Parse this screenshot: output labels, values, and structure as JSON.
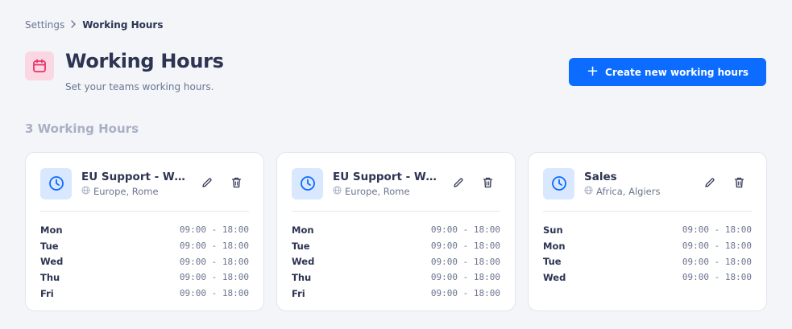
{
  "breadcrumb": {
    "parent": "Settings",
    "separator": "›",
    "current": "Working Hours"
  },
  "header": {
    "title": "Working Hours",
    "subtitle": "Set your teams working hours.",
    "create_button_label": "Create new working hours",
    "create_button_icon": "+"
  },
  "section": {
    "count_label": "3 Working Hours"
  },
  "colors": {
    "accent": "#0b6cff",
    "page_icon_bg": "#fbd7e3",
    "page_icon_fg": "#e8336b",
    "clock_bg": "#d9e8ff"
  },
  "cards": [
    {
      "name": "EU Support - We...",
      "timezone": "Europe, Rome",
      "schedule": [
        {
          "day": "Mon",
          "hours": "09:00 - 18:00"
        },
        {
          "day": "Tue",
          "hours": "09:00 - 18:00"
        },
        {
          "day": "Wed",
          "hours": "09:00 - 18:00"
        },
        {
          "day": "Thu",
          "hours": "09:00 - 18:00"
        },
        {
          "day": "Fri",
          "hours": "09:00 - 18:00"
        }
      ]
    },
    {
      "name": "EU Support - We...",
      "timezone": "Europe, Rome",
      "schedule": [
        {
          "day": "Mon",
          "hours": "09:00 - 18:00"
        },
        {
          "day": "Tue",
          "hours": "09:00 - 18:00"
        },
        {
          "day": "Wed",
          "hours": "09:00 - 18:00"
        },
        {
          "day": "Thu",
          "hours": "09:00 - 18:00"
        },
        {
          "day": "Fri",
          "hours": "09:00 - 18:00"
        }
      ]
    },
    {
      "name": "Sales",
      "timezone": "Africa, Algiers",
      "schedule": [
        {
          "day": "Sun",
          "hours": "09:00 - 18:00"
        },
        {
          "day": "Mon",
          "hours": "09:00 - 18:00"
        },
        {
          "day": "Tue",
          "hours": "09:00 - 18:00"
        },
        {
          "day": "Wed",
          "hours": "09:00 - 18:00"
        }
      ]
    }
  ]
}
